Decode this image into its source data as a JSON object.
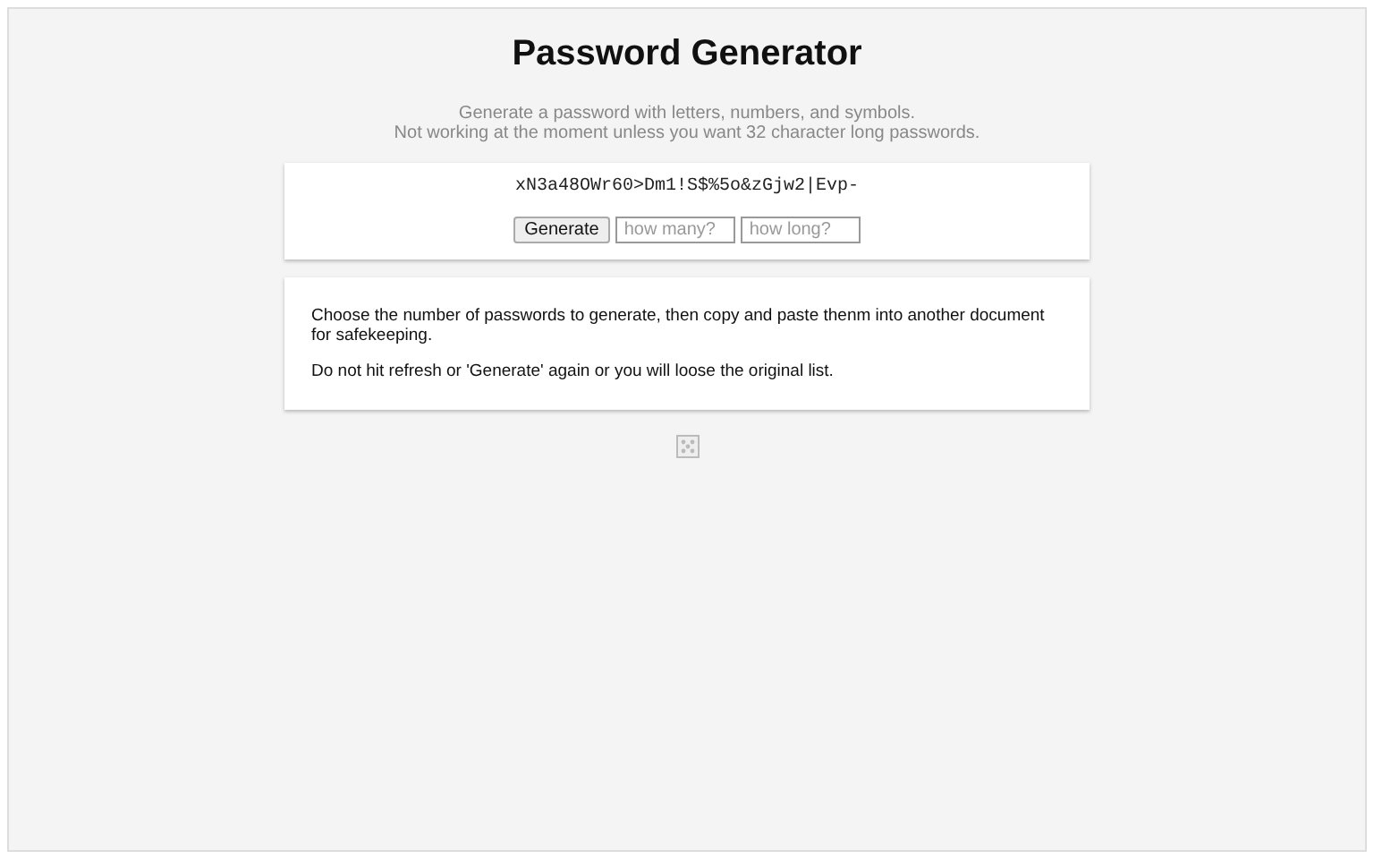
{
  "title": "Password Generator",
  "subtitle": [
    "Generate a password with letters, numbers, and symbols.",
    "Not working at the moment unless you want 32 character long passwords."
  ],
  "generator": {
    "password": "xN3a48OWr60>Dm1!S$%5o&zGjw2|Evp-",
    "button": "Generate",
    "fields": [
      {
        "placeholder": "how many?"
      },
      {
        "placeholder": "how long?"
      }
    ]
  },
  "instructions": [
    "Choose the number of passwords to generate, then copy and paste thenm into another document for safekeeping.",
    "Do not hit refresh or 'Generate' again or you will loose the original list."
  ]
}
